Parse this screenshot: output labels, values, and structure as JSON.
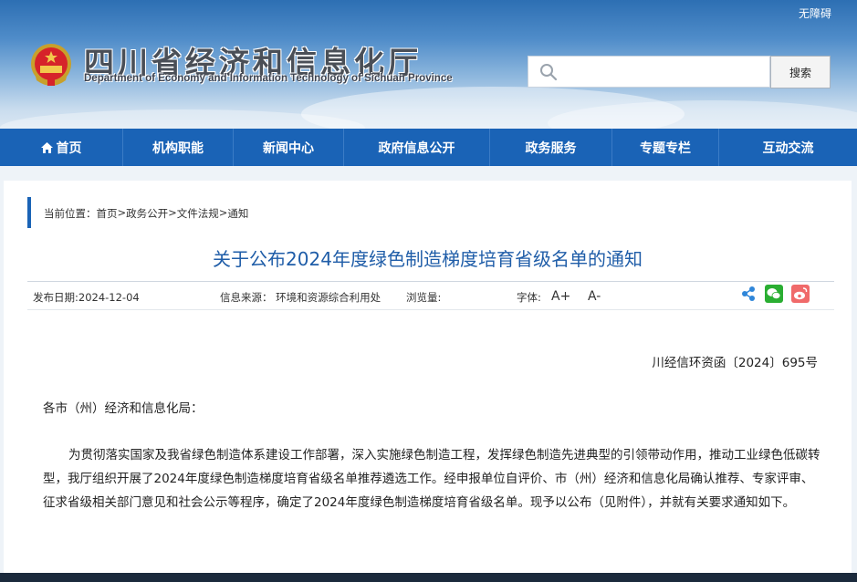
{
  "header": {
    "accessibility_link": "无障碍",
    "title": "四川省经济和信息化厅",
    "subtitle": "Department of Economy and Information Technology of Sichuan Province",
    "search": {
      "placeholder": "",
      "value": "",
      "button_label": "搜索"
    }
  },
  "nav": {
    "items": [
      {
        "label": "首页",
        "icon": "home-icon"
      },
      {
        "label": "机构职能"
      },
      {
        "label": "新闻中心"
      },
      {
        "label": "政府信息公开"
      },
      {
        "label": "政务服务"
      },
      {
        "label": "专题专栏"
      },
      {
        "label": "互动交流"
      }
    ]
  },
  "breadcrumb": {
    "prefix": "当前位置：",
    "items": [
      "首页",
      "政务公开",
      "文件法规",
      "通知"
    ],
    "separator": ">"
  },
  "article": {
    "title": "关于公布2024年度绿色制造梯度培育省级名单的通知",
    "publish_date": "发布日期:2024-12-04",
    "source": "信息来源：  环境和资源综合利用处",
    "views": "浏览量:",
    "font_size_label": "字体:",
    "font_increase": "A+",
    "font_decrease": "A-",
    "share_icons": [
      "share-icon",
      "wechat-icon",
      "weibo-icon"
    ],
    "doc_number": "川经信环资函〔2024〕695号",
    "addressee": "各市（州）经济和信息化局：",
    "paragraph1": "为贯彻落实国家及我省绿色制造体系建设工作部署，深入实施绿色制造工程，发挥绿色制造先进典型的引领带动作用，推动工业绿色低碳转型，我厅组织开展了2024年度绿色制造梯度培育省级名单推荐遴选工作。经申报单位自评价、市（州）经济和信息化局确认推荐、专家评审、征求省级相关部门意见和社会公示等程序，确定了2024年度绿色制造梯度培育省级名单。现予以公布（见附件），并就有关要求通知如下。"
  },
  "colors": {
    "nav_bg": "#1a63b6",
    "title_color": "#1f5da8",
    "accent_bar": "#1a63b6"
  }
}
